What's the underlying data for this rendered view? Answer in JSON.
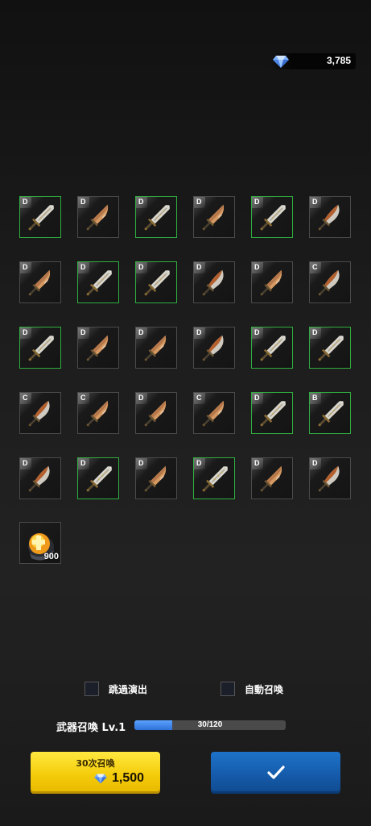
{
  "currency": {
    "icon": "diamond-icon",
    "amount": "3,785"
  },
  "items": [
    {
      "grade": "D",
      "green": true,
      "style": "broad"
    },
    {
      "grade": "D",
      "green": false,
      "style": "copper"
    },
    {
      "grade": "D",
      "green": true,
      "style": "broad"
    },
    {
      "grade": "D",
      "green": false,
      "style": "copper"
    },
    {
      "grade": "D",
      "green": true,
      "style": "broad"
    },
    {
      "grade": "D",
      "green": false,
      "style": "curved"
    },
    {
      "grade": "D",
      "green": false,
      "style": "copper"
    },
    {
      "grade": "D",
      "green": true,
      "style": "broad"
    },
    {
      "grade": "D",
      "green": true,
      "style": "broad"
    },
    {
      "grade": "D",
      "green": false,
      "style": "curved"
    },
    {
      "grade": "D",
      "green": false,
      "style": "copper"
    },
    {
      "grade": "C",
      "green": false,
      "style": "curved"
    },
    {
      "grade": "D",
      "green": true,
      "style": "broad"
    },
    {
      "grade": "D",
      "green": false,
      "style": "copper"
    },
    {
      "grade": "D",
      "green": false,
      "style": "copper"
    },
    {
      "grade": "D",
      "green": false,
      "style": "curved"
    },
    {
      "grade": "D",
      "green": true,
      "style": "broad"
    },
    {
      "grade": "D",
      "green": true,
      "style": "broad"
    },
    {
      "grade": "C",
      "green": false,
      "style": "curved"
    },
    {
      "grade": "C",
      "green": false,
      "style": "copper"
    },
    {
      "grade": "D",
      "green": false,
      "style": "copper"
    },
    {
      "grade": "C",
      "green": false,
      "style": "copper"
    },
    {
      "grade": "D",
      "green": true,
      "style": "broad"
    },
    {
      "grade": "B",
      "green": true,
      "style": "broad"
    },
    {
      "grade": "D",
      "green": false,
      "style": "curved"
    },
    {
      "grade": "D",
      "green": true,
      "style": "broad"
    },
    {
      "grade": "D",
      "green": false,
      "style": "copper"
    },
    {
      "grade": "D",
      "green": true,
      "style": "broad"
    },
    {
      "grade": "D",
      "green": false,
      "style": "copper"
    },
    {
      "grade": "D",
      "green": false,
      "style": "curved"
    }
  ],
  "bonus_item": {
    "icon": "enhance-stone-icon",
    "count": "900"
  },
  "toggles": {
    "skip_animation": {
      "label": "跳過演出",
      "checked": false
    },
    "auto_summon": {
      "label": "自動召喚",
      "checked": false
    }
  },
  "level": {
    "label": "武器召喚 Lv.1",
    "progress_text": "30/120",
    "current": 30,
    "max": 120
  },
  "summon_button": {
    "title": "30次召喚",
    "cost": "1,500",
    "icon": "diamond-icon"
  },
  "confirm_button": {
    "icon": "check-icon"
  },
  "colors": {
    "green_frame": "#2fae3f",
    "gray_frame": "#4a4a4a",
    "progress": "#3a86ec",
    "summon_yellow": "#f4cc0a",
    "confirm_blue": "#1559a8"
  }
}
